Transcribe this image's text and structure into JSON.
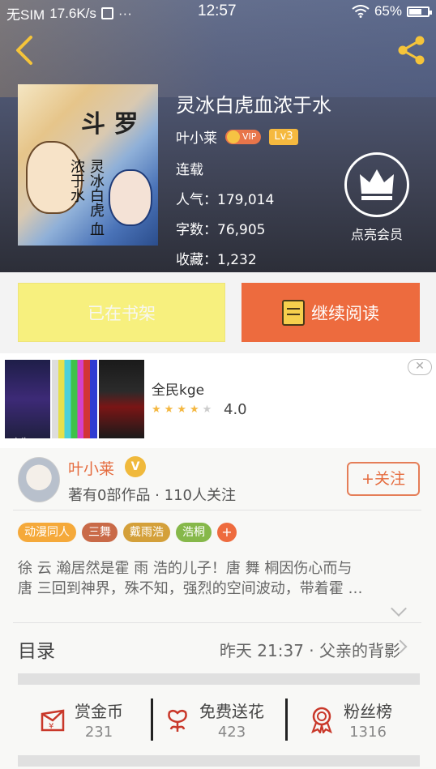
{
  "status_bar": {
    "carrier": "无SIM",
    "speed": "17.6K/s",
    "dots": "···",
    "time": "12:57",
    "battery": "65%"
  },
  "book": {
    "title": "灵冰白虎血浓于水",
    "author": "叶小莱",
    "vip": "VIP",
    "level": "Lv3",
    "status": "连载",
    "popularity": "人气：179,014",
    "word_count": "字数：76,905",
    "favorites": "收藏：1,232",
    "cover_title": "斗 罗",
    "cover_subtitle": "灵冰白虎 血浓于水"
  },
  "member": {
    "label": "点亮会员"
  },
  "actions": {
    "shelf_label": "已在书架",
    "read_label": "继续阅读"
  },
  "ad": {
    "tag": "广告",
    "app_name": "全民kge",
    "rating": "4.0",
    "stars_filled": 4,
    "stars_total": 5
  },
  "author_card": {
    "name": "叶小莱",
    "v_badge": "V",
    "stats": "著有0部作品 · 110人关注",
    "follow_label": "+关注"
  },
  "tags": [
    {
      "label": "动漫同人",
      "color": "#f5a93a"
    },
    {
      "label": "三舞",
      "color": "#c96a48"
    },
    {
      "label": "戴雨浩",
      "color": "#d4a03a"
    },
    {
      "label": "浩桐",
      "color": "#86b84a"
    },
    {
      "label": "+",
      "color": "#ee6b3e"
    }
  ],
  "synopsis": {
    "line1": "徐 云 瀚居然是霍 雨 浩的儿子！唐 舞 桐因伤心而与",
    "line2": "唐 三回到神界，殊不知，强烈的空间波动，带着霍 …"
  },
  "toc": {
    "label": "目录",
    "latest": "昨天 21:37  ·  父亲的背影"
  },
  "rewards": [
    {
      "label": "赏金币",
      "value": "231",
      "icon": "money-envelope-icon"
    },
    {
      "label": "免费送花",
      "value": "423",
      "icon": "flower-icon"
    },
    {
      "label": "粉丝榜",
      "value": "1316",
      "icon": "medal-icon"
    }
  ],
  "colors": {
    "accent_orange": "#ed6b3e",
    "shelf_yellow": "#f7f07e",
    "reward_red": "#c9382a"
  }
}
